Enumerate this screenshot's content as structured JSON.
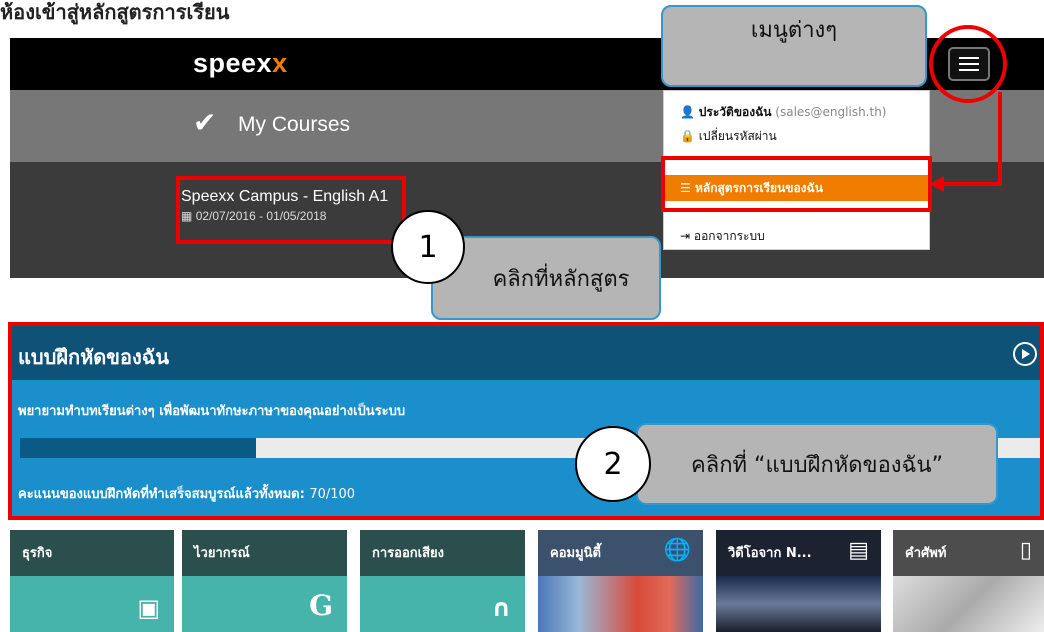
{
  "page_heading": "ห้องเข้าสู่หลักสูตรการเรียน",
  "app": {
    "logo_main": "speex",
    "logo_x": "x",
    "nav_title": "My Courses",
    "brand_color": "#f07d00"
  },
  "course": {
    "title": "Speexx Campus - English A1",
    "dates": "02/07/2016 - 01/05/2018"
  },
  "menu": {
    "profile_label": "ประวัติของฉัน",
    "profile_email": "(sales@english.th)",
    "change_password": "เปลี่ยนรหัสผ่าน",
    "my_courses": "หลักสูตรการเรียนของฉัน",
    "logout": "ออกจากระบบ"
  },
  "callouts": {
    "menus": "เมนูต่างๆ",
    "step1_number": "1",
    "step1_text": "คลิกที่หลักสูตร",
    "step2_number": "2",
    "step2_text": "คลิกที่ “แบบฝึกหัดของฉัน”"
  },
  "practice": {
    "title": "แบบฝึกหัดของฉัน",
    "description": "พยายามทำบทเรียนต่างๆ เพื่อพัฒนาทักษะภาษาของคุณอย่างเป็นระบบ",
    "progress": 0.23,
    "score_label": "คะแนนของแบบฝึกหัดที่ทำเสร็จสมบูรณ์แล้วทั้งหมด:",
    "score_value": "70/100"
  },
  "tiles": [
    {
      "label": "ธุรกิจ",
      "icon": "money-icon"
    },
    {
      "label": "ไวยากรณ์",
      "icon": "grammar-g-icon"
    },
    {
      "label": "การออกเสียง",
      "icon": "headphones-icon"
    },
    {
      "label": "คอมมูนิตี้",
      "icon": "globe-icon"
    },
    {
      "label": "วิดีโอจาก N...",
      "icon": "film-icon"
    },
    {
      "label": "คำศัพท์",
      "icon": "mobile-icon"
    }
  ]
}
